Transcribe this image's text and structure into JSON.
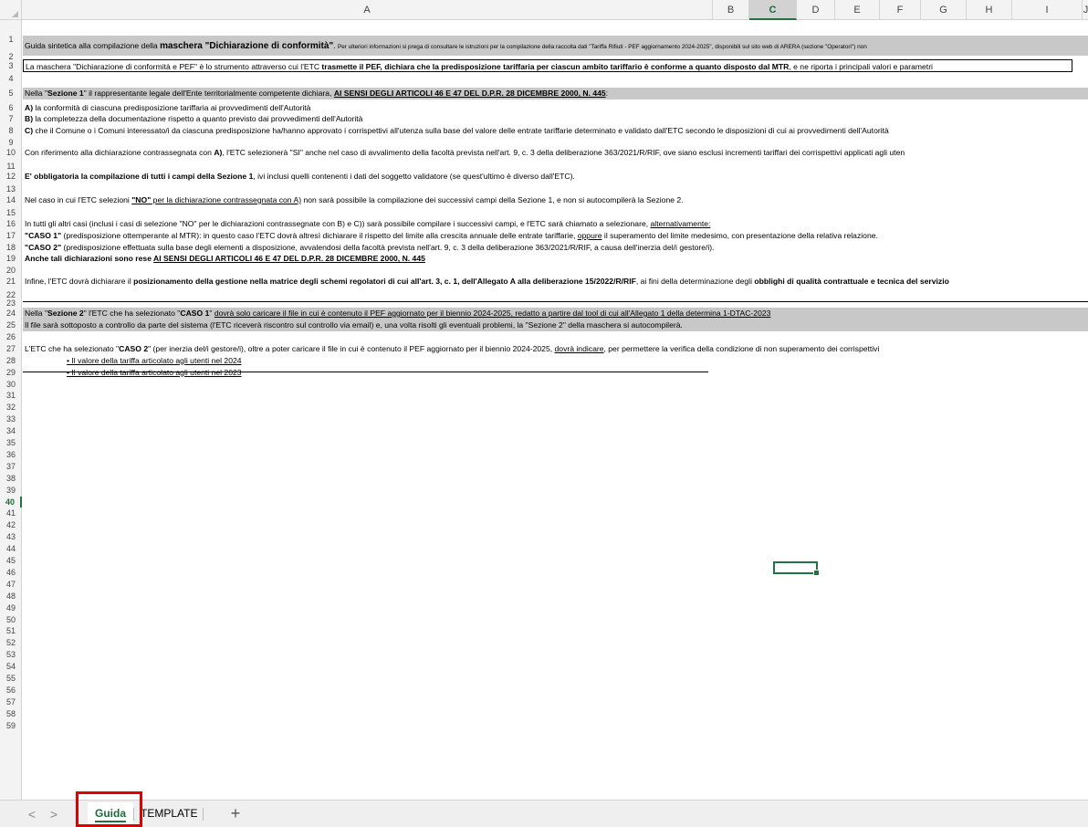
{
  "columns": [
    "A",
    "B",
    "C",
    "D",
    "E",
    "F",
    "G",
    "H",
    "I",
    "J"
  ],
  "selected_column": "C",
  "selected_row": 40,
  "rows": [
    {
      "n": "1",
      "parts": [
        [
          "Guida sintetica alla compilazione della ",
          0,
          0
        ],
        [
          "maschera \"Dichiarazione di conformità\"",
          1,
          0
        ],
        [
          ".  ",
          0,
          0
        ],
        [
          "Per ulteriori informazioni si prega di consultare le istruzioni per la compilazione della raccolta dati \"Tariffa Rifiuti - PEF aggiornamento 2024-2025\", disponibili sul sito web di ARERA (sezione \"Operatori\") non",
          0,
          0
        ]
      ]
    },
    {
      "n": "3",
      "parts": [
        [
          "La maschera \"Dichiarazione di conformità e PEF\" è lo strumento attraverso cui l'ETC ",
          0,
          0
        ],
        [
          "trasmette il PEF, dichiara che la predisposizione tariffaria per ciascun ambito tariffario è conforme a quanto disposto dal MTR",
          1,
          0
        ],
        [
          ", e ne riporta i principali valori e parametri",
          0,
          0
        ]
      ]
    },
    {
      "n": "5",
      "parts": [
        [
          "Nella \"",
          0,
          0
        ],
        [
          "Sezione 1",
          1,
          0
        ],
        [
          "\" il rappresentante legale dell'Ente territorialmente competente dichiara, ",
          0,
          0
        ],
        [
          "AI SENSI DEGLI ARTICOLI 46 E 47 DEL D.P.R. 28 DICEMBRE 2000, N. 445",
          1,
          1
        ],
        [
          ":",
          0,
          0
        ]
      ]
    },
    {
      "n": "6",
      "parts": [
        [
          "A)",
          1,
          0
        ],
        [
          " la conformità di ciascuna predisposizione tariffaria ai provvedimenti dell'Autorità",
          0,
          0
        ]
      ]
    },
    {
      "n": "7",
      "parts": [
        [
          "B)",
          1,
          0
        ],
        [
          " la completezza della documentazione rispetto a quanto previsto dai provvedimenti dell'Autorità",
          0,
          0
        ]
      ]
    },
    {
      "n": "8",
      "parts": [
        [
          "C)",
          1,
          0
        ],
        [
          " che il Comune o i Comuni interessato/i da ciascuna predisposizione ha/hanno approvato i corrispettivi all'utenza sulla base del valore delle entrate tariffarie determinato e validato dall'ETC secondo le disposizioni di cui ai provvedimenti dell'Autorità",
          0,
          0
        ]
      ]
    },
    {
      "n": "10",
      "parts": [
        [
          "Con riferimento alla dichiarazione contrassegnata con ",
          0,
          0
        ],
        [
          "A)",
          1,
          0
        ],
        [
          ", l'ETC selezionerà \"SI\" anche nel caso di avvalimento della facoltà prevista nell'art. 9, c. 3 della deliberazione 363/2021/R/RIF, ove siano esclusi incrementi tariffari dei corrispettivi applicati agli uten",
          0,
          0
        ]
      ]
    },
    {
      "n": "12",
      "parts": [
        [
          "E' obbligatoria la compilazione di tutti i campi della Sezione 1",
          1,
          0
        ],
        [
          ", ivi inclusi quelli contenenti i dati del soggetto validatore (se quest'ultimo è diverso dall'ETC).",
          0,
          0
        ]
      ]
    },
    {
      "n": "14",
      "parts": [
        [
          "Nel caso in cui l'ETC selezioni ",
          0,
          0
        ],
        [
          "\"NO\"",
          1,
          1
        ],
        [
          " per la dichiarazione contrassegnata con A)",
          0,
          1
        ],
        [
          " non sarà possibile la compilazione dei successivi campi della Sezione 1, e non si autocompilerà la Sezione 2.",
          0,
          0
        ]
      ]
    },
    {
      "n": "16",
      "parts": [
        [
          "In tutti gli altri casi (inclusi i casi di selezione \"NO\" per le dichiarazioni contrassegnate con B) e C)) sarà possibile compilare i successivi campi, e l'ETC sarà chiamato a selezionare, ",
          0,
          0
        ],
        [
          "alternativamente:",
          0,
          1
        ]
      ]
    },
    {
      "n": "17",
      "parts": [
        [
          "\"CASO 1\"",
          1,
          0
        ],
        [
          " (predisposizione ottemperante al MTR): in questo caso l'ETC dovrà altresì dichiarare il rispetto del limite alla crescita annuale delle entrate tariffarie, ",
          0,
          0
        ],
        [
          "oppure",
          0,
          1
        ],
        [
          " il superamento del limite medesimo, con presentazione della relativa relazione.",
          0,
          0
        ]
      ]
    },
    {
      "n": "18",
      "parts": [
        [
          "\"CASO 2\"",
          1,
          0
        ],
        [
          " (predisposizione effettuata sulla base degli elementi a disposizione, avvalendosi della facoltà prevista nell'art. 9, c. 3 della deliberazione 363/2021/R/RIF, a causa dell'inerzia del/i gestore/i).",
          0,
          0
        ]
      ]
    },
    {
      "n": "19",
      "parts": [
        [
          "Anche tali dichiarazioni sono rese ",
          1,
          0
        ],
        [
          "AI SENSI DEGLI ARTICOLI 46 E 47 DEL D.P.R. 28 DICEMBRE 2000, N. 445",
          1,
          1
        ]
      ]
    },
    {
      "n": "21",
      "parts": [
        [
          "Infine, l'ETC dovrà dichiarare il ",
          0,
          0
        ],
        [
          "posizionamento della gestione nella matrice degli schemi regolatori di cui all'art. 3, c. 1, dell'Allegato A alla deliberazione 15/2022/R/RIF",
          1,
          0
        ],
        [
          ", ai fini della determinazione degli ",
          0,
          0
        ],
        [
          "obblighi di qualità contrattuale e tecnica del servizio",
          1,
          0
        ]
      ]
    },
    {
      "n": "24",
      "parts": [
        [
          "Nella \"",
          0,
          0
        ],
        [
          "Sezione 2",
          1,
          0
        ],
        [
          "\" l'ETC che ha selezionato \"",
          0,
          0
        ],
        [
          "CASO 1",
          1,
          0
        ],
        [
          "\" ",
          0,
          0
        ],
        [
          "dovrà solo caricare il file in cui è contenuto il PEF aggiornato per il biennio 2024-2025, redatto a partire dal tool di cui all'Allegato 1 della determina 1-DTAC-2023",
          0,
          1
        ]
      ]
    },
    {
      "n": "25",
      "parts": [
        [
          "Il file sarà sottoposto a controllo da parte del sistema (l'ETC riceverà riscontro sul controllo via email) e, una volta risolti gli eventuali problemi, la \"Sezione 2\" della maschera si autocompilerà.",
          0,
          0
        ]
      ]
    },
    {
      "n": "27",
      "parts": [
        [
          "L'ETC che ha selezionato \"",
          0,
          0
        ],
        [
          "CASO 2",
          1,
          0
        ],
        [
          "\" (per inerzia del/i gestore/i), oltre a poter caricare il file in cui è contenuto il PEF aggiornato per il biennio 2024-2025, ",
          0,
          0
        ],
        [
          "dovrà indicare",
          0,
          1
        ],
        [
          ", per permettere la verifica della condizione di non superamento dei corrispettivi",
          0,
          0
        ]
      ]
    },
    {
      "n": "28",
      "parts": [
        [
          "• Il valore della tariffa articolato agli utenti nel 2024",
          0,
          1
        ]
      ]
    },
    {
      "n": "29",
      "parts": [
        [
          "• Il valore della tariffa articolato agli utenti nel 2023",
          0,
          1
        ]
      ]
    }
  ],
  "tabs": {
    "prev_label": "<",
    "next_label": ">",
    "sheets": [
      "Guida",
      "TEMPLATE"
    ],
    "active": "Guida",
    "add_label": "+"
  }
}
